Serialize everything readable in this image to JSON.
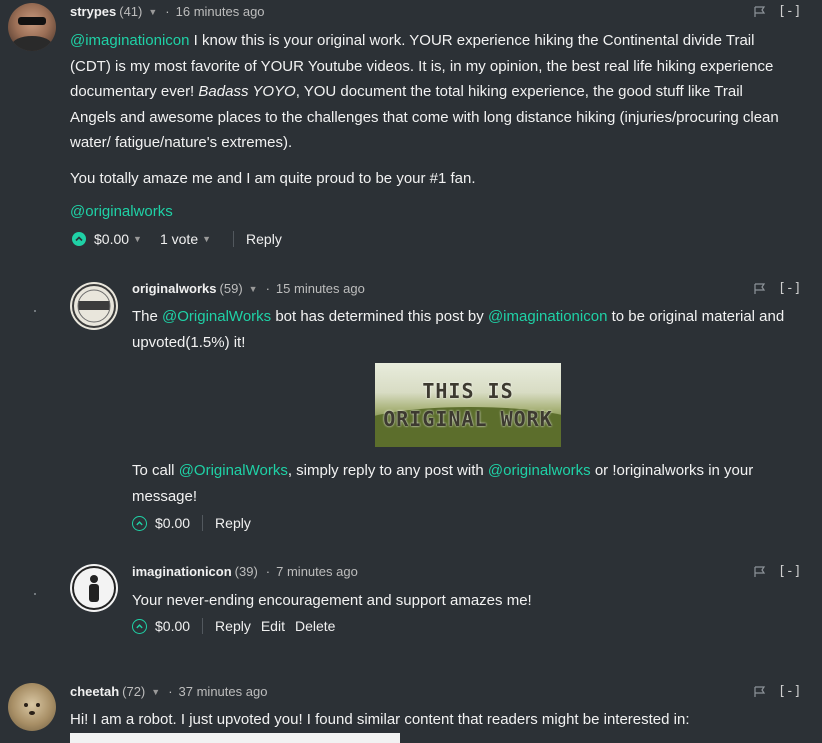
{
  "comments": [
    {
      "author": "strypes",
      "rep": "(41)",
      "time": "16 minutes ago",
      "collapse": "[-]",
      "lines": {
        "mention": "@imaginationicon",
        "p1a": " I know this is your original work. YOUR experience hiking the Continental divide Trail (CDT) is my most favorite of YOUR Youtube videos. It is, in my opinion, the best real life hiking experience documentary ever! ",
        "p1em": "Badass YOYO",
        "p1b": ", YOU document the total hiking experience, the good stuff like Trail Angels and awesome places to the challenges that come with long distance hiking (injuries/procuring clean water/ fatigue/nature's extremes).",
        "p2": "You totally amaze me and I am quite proud to be your #1 fan.",
        "p3": "@originalworks"
      },
      "payout": "$0.00",
      "votes": "1 vote",
      "reply": "Reply"
    },
    {
      "author": "originalworks",
      "rep": "(59)",
      "time": "15 minutes ago",
      "collapse": "[-]",
      "lines": {
        "p1a": "The ",
        "p1link1": "@OriginalWorks",
        "p1b": " bot has determined this post by ",
        "p1link2": "@imaginationicon",
        "p1c": " to be original material and upvoted(1.5%) it!",
        "banner1": "THIS IS",
        "banner2": "ORIGINAL WORK",
        "p2a": "To call ",
        "p2link1": "@OriginalWorks",
        "p2b": ", simply reply to any post with ",
        "p2link2": "@originalworks",
        "p2c": " or !originalworks in your message!"
      },
      "payout": "$0.00",
      "reply": "Reply"
    },
    {
      "author": "imaginationicon",
      "rep": "(39)",
      "time": "7 minutes ago",
      "collapse": "[-]",
      "text": "Your never-ending encouragement and support amazes me!",
      "payout": "$0.00",
      "reply": "Reply",
      "edit": "Edit",
      "delete": "Delete"
    },
    {
      "author": "cheetah",
      "rep": "(72)",
      "time": "37 minutes ago",
      "collapse": "[-]",
      "text": "Hi! I am a robot. I just upvoted you! I found similar content that readers might be interested in:"
    }
  ],
  "colors": {
    "background": "#2c3136",
    "accent": "#1fd1a6"
  },
  "icons": [
    "flag-icon",
    "upvote-icon",
    "chevron-down-icon"
  ]
}
